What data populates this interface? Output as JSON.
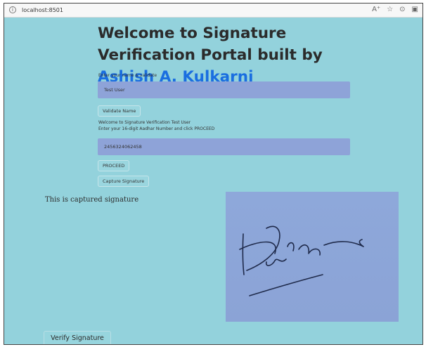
{
  "browser": {
    "url": "localhost:8501",
    "icons": [
      "info-icon",
      "font-size-icon",
      "star-icon",
      "extension-icon",
      "collections-icon"
    ]
  },
  "header": {
    "title_prefix": "Welcome to Signature Verification Portal built by",
    "title_link": "Ashish A. Kulkarni"
  },
  "form": {
    "name_label": "Enter your name & validate",
    "name_value": "Test User",
    "validate_label": "Validate Name",
    "welcome_text": "Welcome to Signature Verification Test User",
    "aadhar_label": "Enter your 16-digit Aadhar Number and click PROCEED",
    "aadhar_value": "2456324062458",
    "proceed_label": "PROCEED",
    "capture_label": "Capture Signature"
  },
  "signature": {
    "caption": "This is captured signature"
  },
  "actions": {
    "verify_label": "Verify Signature"
  },
  "colors": {
    "page_bg": "#93d2dc",
    "input_bg": "#8ea3d8",
    "link": "#1a6ee0"
  }
}
